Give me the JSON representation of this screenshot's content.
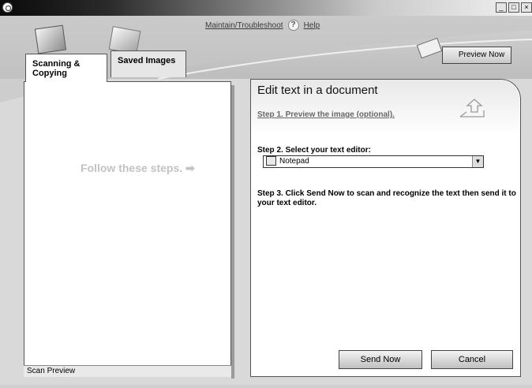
{
  "window": {
    "minimize_symbol": "_",
    "maximize_symbol": "□",
    "close_symbol": "×"
  },
  "menu": {
    "maintain": "Maintain/Troubleshoot",
    "help": "Help",
    "help_symbol": "?"
  },
  "tabs": {
    "scanning": "Scanning & Copying",
    "saved": "Saved Images"
  },
  "preview_button": "Preview Now",
  "left_panel": {
    "follow_text": "Follow these steps.",
    "follow_arrow": "➡",
    "status": "Scan Preview"
  },
  "right_panel": {
    "title": "Edit text in a document",
    "step1": "Step 1.  Preview the image (optional).",
    "step2": "Step 2.  Select your text editor:",
    "editor_selected": "Notepad",
    "dropdown_symbol": "▼",
    "step3": "Step 3.  Click Send Now to scan and recognize the text then send it to your text editor.",
    "send_button": "Send Now",
    "cancel_button": "Cancel"
  }
}
